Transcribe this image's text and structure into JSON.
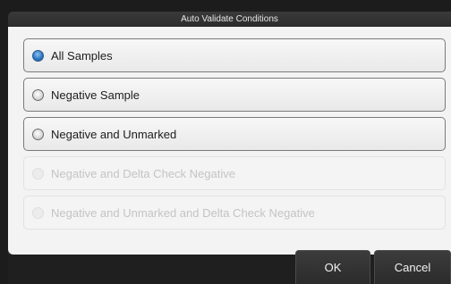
{
  "dialog": {
    "title": "Auto Validate Conditions"
  },
  "options": [
    {
      "label": "All Samples",
      "checked": true,
      "enabled": true
    },
    {
      "label": "Negative Sample",
      "checked": false,
      "enabled": true
    },
    {
      "label": "Negative and Unmarked",
      "checked": false,
      "enabled": true
    },
    {
      "label": "Negative and Delta Check Negative",
      "checked": false,
      "enabled": false
    },
    {
      "label": "Negative and Unmarked and Delta Check Negative",
      "checked": false,
      "enabled": false
    }
  ],
  "buttons": {
    "ok_label": "OK",
    "cancel_label": "Cancel"
  },
  "colors": {
    "accent": "#2f79c4",
    "background": "#f3f3f3",
    "chrome": "#2a2a2a"
  }
}
